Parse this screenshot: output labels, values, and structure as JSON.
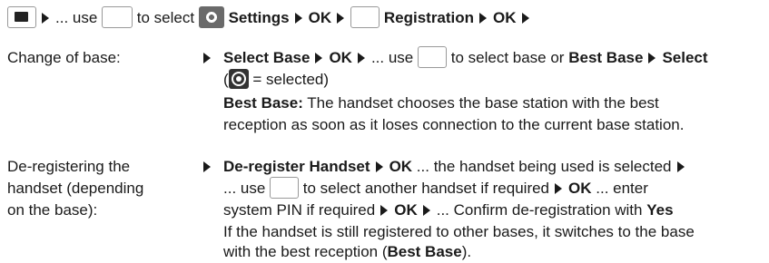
{
  "nav": {
    "icon_menu": "menu-key-icon",
    "text_use": "... use",
    "icon_nav": "navigation-key-icon",
    "text_select": "to select",
    "icon_settings": "settings-gear-icon",
    "settings": "Settings",
    "ok1": "OK",
    "icon_nav2": "up-down-key-icon",
    "registration": "Registration",
    "ok2": "OK"
  },
  "rows": [
    {
      "label": "Change of base:",
      "l1_a": "Select Base",
      "l1_b": "OK",
      "l1_c": "... use",
      "l1_d": "to select base or",
      "l1_e": "Best Base",
      "l1_f": "Select",
      "l2_a": "(",
      "l2_b": "= selected)",
      "l3_a": "Best Base:",
      "l3_b": "The handset chooses the base station with the best",
      "l4": "reception as soon as it loses connection to the current base station."
    },
    {
      "label_1": "De-registering the",
      "label_2": "handset (depending",
      "label_3": "on the base):",
      "l1_a": "De-register Handset",
      "l1_b": "OK",
      "l1_c": "... the handset being used is selected",
      "l2_a": "... use",
      "l2_b": "to select another handset if required",
      "l2_c": "OK",
      "l2_d": "... enter",
      "l3_a": "system PIN if required",
      "l3_b": "OK",
      "l3_c": "... Confirm de-registration with",
      "l3_d": "Yes",
      "l4": "If the handset is still registered to other bases, it switches to the base",
      "l5_a": "with the best reception (",
      "l5_b": "Best Base",
      "l5_c": ")."
    }
  ]
}
